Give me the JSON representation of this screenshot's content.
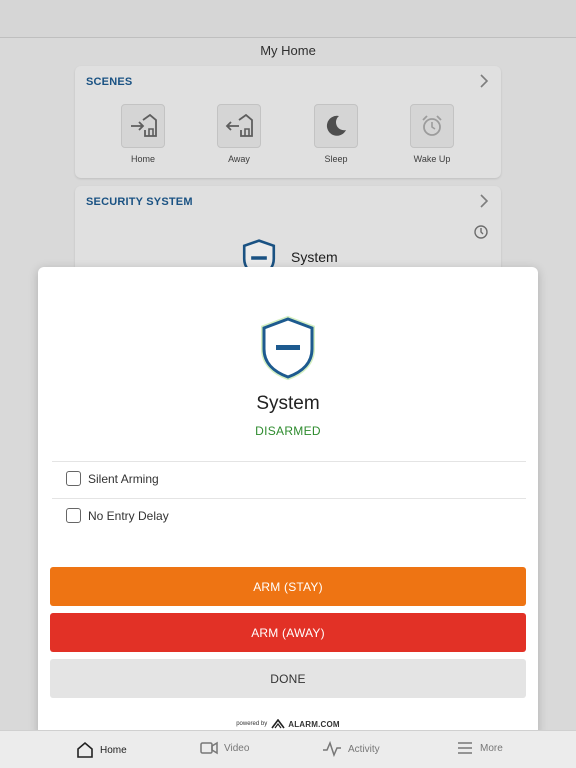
{
  "header": {
    "title": "My Home"
  },
  "scenes": {
    "title": "SCENES",
    "items": [
      {
        "label": "Home",
        "icon": "home-arrive-icon"
      },
      {
        "label": "Away",
        "icon": "home-leave-icon"
      },
      {
        "label": "Sleep",
        "icon": "moon-icon"
      },
      {
        "label": "Wake Up",
        "icon": "alarm-clock-icon"
      }
    ]
  },
  "security": {
    "title": "SECURITY SYSTEM",
    "system_name": "System"
  },
  "modal": {
    "system_name": "System",
    "status": "DISARMED",
    "options": [
      {
        "label": "Silent Arming",
        "checked": false
      },
      {
        "label": "No Entry Delay",
        "checked": false
      }
    ],
    "arm_stay_label": "ARM (STAY)",
    "arm_away_label": "ARM (AWAY)",
    "done_label": "DONE",
    "powered_by": "powered by",
    "brand": "ALARM.COM"
  },
  "tabs": [
    {
      "label": "Home",
      "icon": "house-icon",
      "active": true
    },
    {
      "label": "Video",
      "icon": "video-camera-icon",
      "active": false
    },
    {
      "label": "Activity",
      "icon": "activity-pulse-icon",
      "active": false
    },
    {
      "label": "More",
      "icon": "menu-lines-icon",
      "active": false
    }
  ],
  "colors": {
    "accent_blue": "#1d5a8f",
    "status_green": "#2e8b2e",
    "arm_stay": "#ee7413",
    "arm_away": "#e23126"
  }
}
